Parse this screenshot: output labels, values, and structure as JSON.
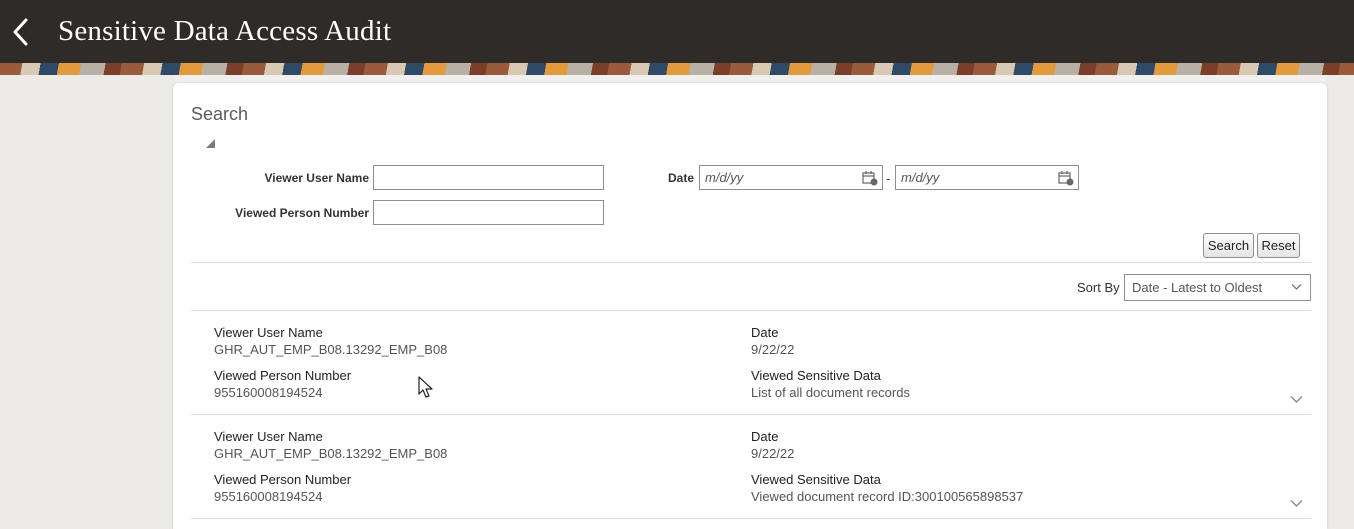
{
  "header": {
    "title": "Sensitive Data Access Audit"
  },
  "search": {
    "title": "Search",
    "viewer_user_name_label": "Viewer User Name",
    "viewed_person_number_label": "Viewed Person Number",
    "date_label": "Date",
    "date_from_placeholder": "m/d/yy",
    "date_to_placeholder": "m/d/yy",
    "date_separator": "-",
    "search_button": "Search",
    "reset_button": "Reset"
  },
  "sort": {
    "label": "Sort By",
    "selected": "Date - Latest to Oldest"
  },
  "records": [
    {
      "viewer_user_name_label": "Viewer User Name",
      "viewer_user_name": "GHR_AUT_EMP_B08.13292_EMP_B08",
      "date_label": "Date",
      "date": "9/22/22",
      "viewed_person_number_label": "Viewed Person Number",
      "viewed_person_number": "955160008194524",
      "viewed_sensitive_data_label": "Viewed Sensitive Data",
      "viewed_sensitive_data": "List of all document records"
    },
    {
      "viewer_user_name_label": "Viewer User Name",
      "viewer_user_name": "GHR_AUT_EMP_B08.13292_EMP_B08",
      "date_label": "Date",
      "date": "9/22/22",
      "viewed_person_number_label": "Viewed Person Number",
      "viewed_person_number": "955160008194524",
      "viewed_sensitive_data_label": "Viewed Sensitive Data",
      "viewed_sensitive_data": "Viewed document record ID:300100565898537"
    }
  ],
  "icons": {
    "back": "chevron-left-icon",
    "collapse": "collapse-triangle-icon",
    "calendar": "calendar-icon",
    "expand": "chevron-down-icon",
    "cursor": "mouse-cursor-icon"
  }
}
